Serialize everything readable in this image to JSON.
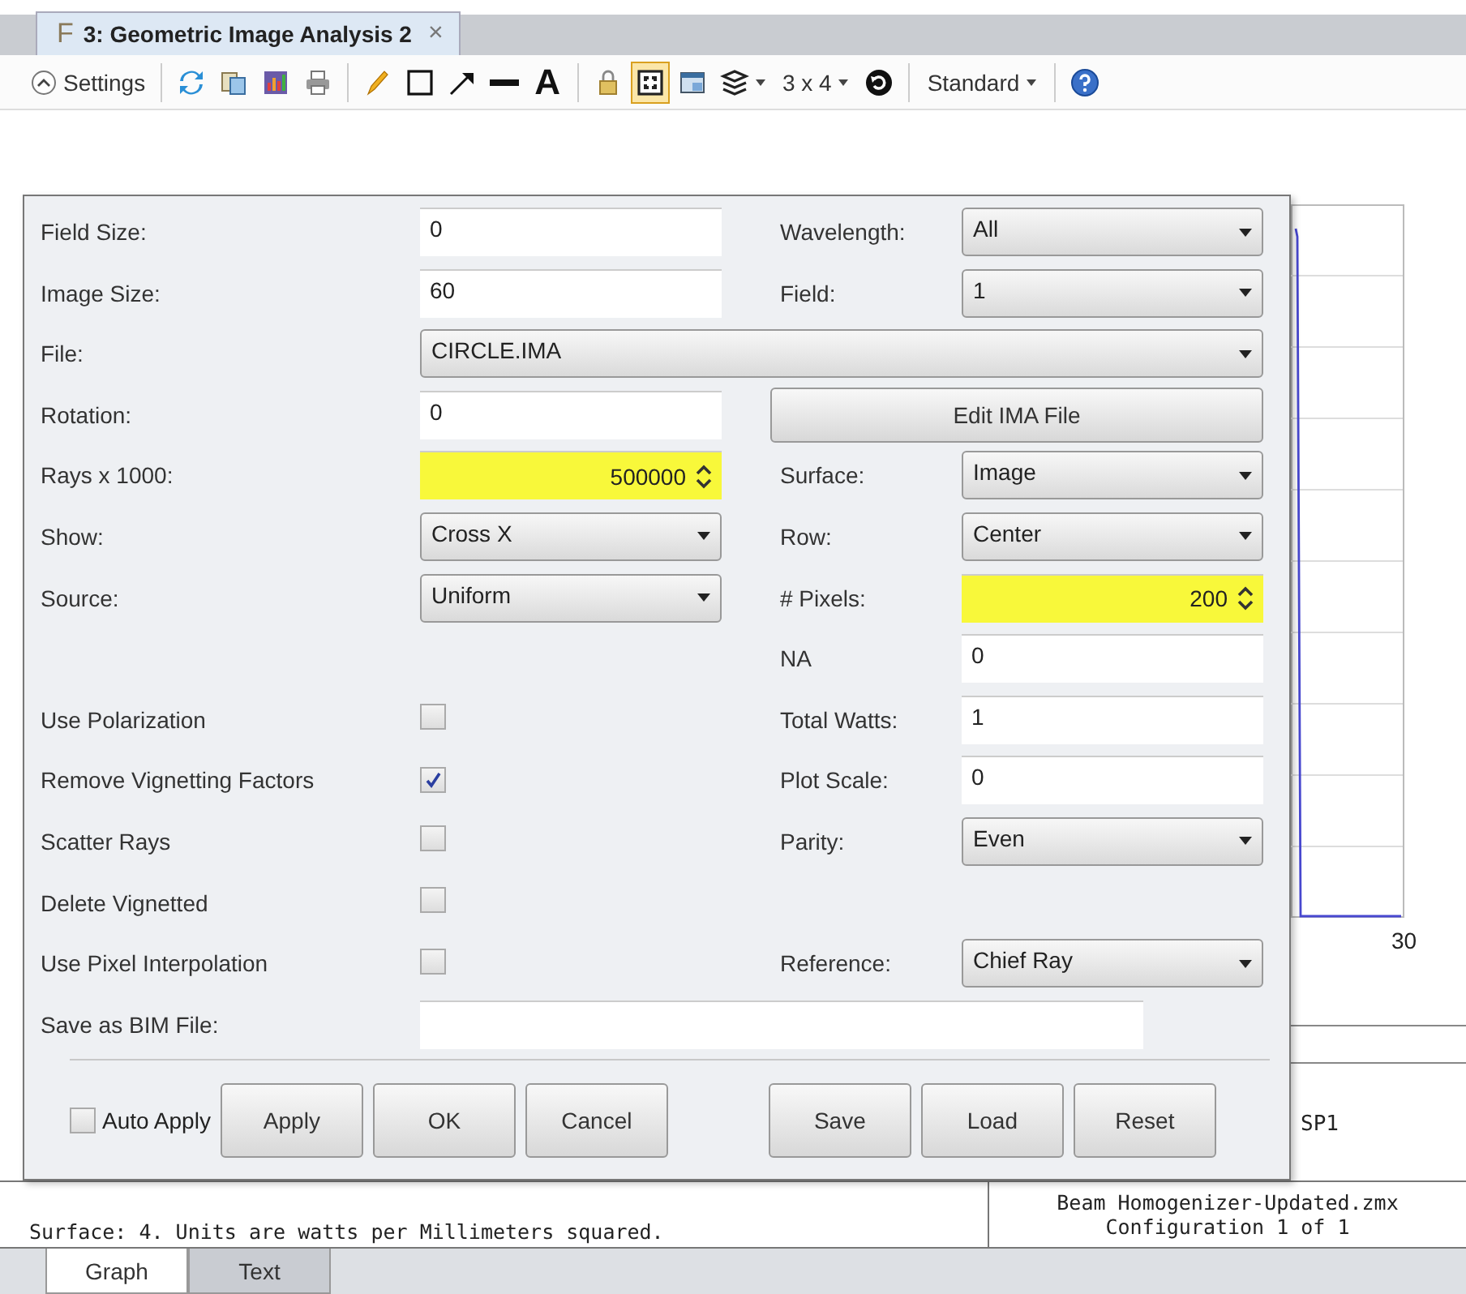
{
  "window": {
    "tab_icon": "F",
    "title": "3: Geometric Image Analysis 2",
    "close": "×"
  },
  "toolbar": {
    "settings_label": "Settings",
    "tools": [
      {
        "kind": "refresh",
        "selected": false
      },
      {
        "kind": "copy",
        "selected": false
      },
      {
        "kind": "save",
        "selected": false
      },
      {
        "kind": "print",
        "selected": false
      },
      {
        "kind": "separator"
      },
      {
        "kind": "pencil",
        "selected": false
      },
      {
        "kind": "rectangle",
        "selected": false
      },
      {
        "kind": "arrow",
        "selected": false
      },
      {
        "kind": "line",
        "selected": false
      },
      {
        "kind": "text",
        "label": "A",
        "selected": false
      },
      {
        "kind": "separator"
      },
      {
        "kind": "lock",
        "selected": false
      },
      {
        "kind": "frame",
        "selected": true
      },
      {
        "kind": "window",
        "selected": false
      },
      {
        "kind": "layers",
        "selected": false,
        "dropdown": true
      },
      {
        "kind": "text",
        "label": "3 x 4",
        "selected": false,
        "dropdown": true
      },
      {
        "kind": "rotate",
        "selected": false
      },
      {
        "kind": "separator"
      },
      {
        "kind": "text",
        "label": "Standard",
        "selected": false,
        "dropdown": true
      },
      {
        "kind": "separator"
      },
      {
        "kind": "help",
        "selected": false
      }
    ]
  },
  "settings": {
    "rows": [
      {
        "left": {
          "label": "Field Size:",
          "kind": "text",
          "value": "0"
        },
        "right": {
          "label": "Wavelength:",
          "kind": "dropdown",
          "value": "All"
        }
      },
      {
        "left": {
          "label": "Image Size:",
          "kind": "text",
          "value": "60"
        },
        "right": {
          "label": "Field:",
          "kind": "dropdown",
          "value": "1"
        }
      },
      {
        "left": {
          "label": "File:",
          "kind": "wide_dropdown",
          "value": "CIRCLE.IMA"
        }
      },
      {
        "left": {
          "label": "Rotation:",
          "kind": "text",
          "value": "0"
        },
        "right": {
          "kind": "button",
          "label": "Edit IMA File"
        }
      },
      {
        "left": {
          "label": "Rays x 1000:",
          "kind": "spinner",
          "value": "500000",
          "highlighted": true
        },
        "right": {
          "label": "Surface:",
          "kind": "dropdown",
          "value": "Image"
        }
      },
      {
        "left": {
          "label": "Show:",
          "kind": "dropdown",
          "value": "Cross X"
        },
        "right": {
          "label": "Row:",
          "kind": "dropdown",
          "value": "Center"
        }
      },
      {
        "left": {
          "label": "Source:",
          "kind": "dropdown",
          "value": "Uniform"
        },
        "right": {
          "label": "# Pixels:",
          "kind": "spinner",
          "value": "200",
          "highlighted": true
        }
      },
      {
        "right": {
          "label": "NA",
          "kind": "text",
          "value": "0"
        }
      },
      {
        "left": {
          "label": "Use Polarization",
          "kind": "checkbox",
          "checked": false
        },
        "right": {
          "label": "Total Watts:",
          "kind": "text",
          "value": "1"
        }
      },
      {
        "left": {
          "label": "Remove Vignetting Factors",
          "kind": "checkbox",
          "checked": true
        },
        "right": {
          "label": "Plot Scale:",
          "kind": "text",
          "value": "0"
        }
      },
      {
        "left": {
          "label": "Scatter Rays",
          "kind": "checkbox",
          "checked": false
        },
        "right": {
          "label": "Parity:",
          "kind": "dropdown",
          "value": "Even"
        }
      },
      {
        "left": {
          "label": "Delete Vignetted",
          "kind": "checkbox",
          "checked": false
        }
      },
      {
        "left": {
          "label": "Use Pixel Interpolation",
          "kind": "checkbox",
          "checked": false
        },
        "right": {
          "label": "Reference:",
          "kind": "dropdown",
          "value": "Chief Ray"
        }
      },
      {
        "left": {
          "label": "Save as BIM File:",
          "kind": "wide_text"
        }
      }
    ],
    "auto_apply": {
      "label": "Auto Apply",
      "checked": false
    },
    "apply_buttons": [
      "Apply",
      "OK",
      "Cancel"
    ],
    "file_buttons": [
      "Save",
      "Load",
      "Reset"
    ]
  },
  "graph": {
    "axis_label": "30",
    "legend": "SP1"
  },
  "output": {
    "text": "Surface: 4. Units are watts per Millimeters squared.",
    "file": "Beam Homogenizer-Updated.zmx",
    "configuration": "Configuration 1 of 1"
  },
  "bottom_tabs": [
    {
      "label": "Graph",
      "selected": true
    },
    {
      "label": "Text",
      "selected": false
    }
  ]
}
